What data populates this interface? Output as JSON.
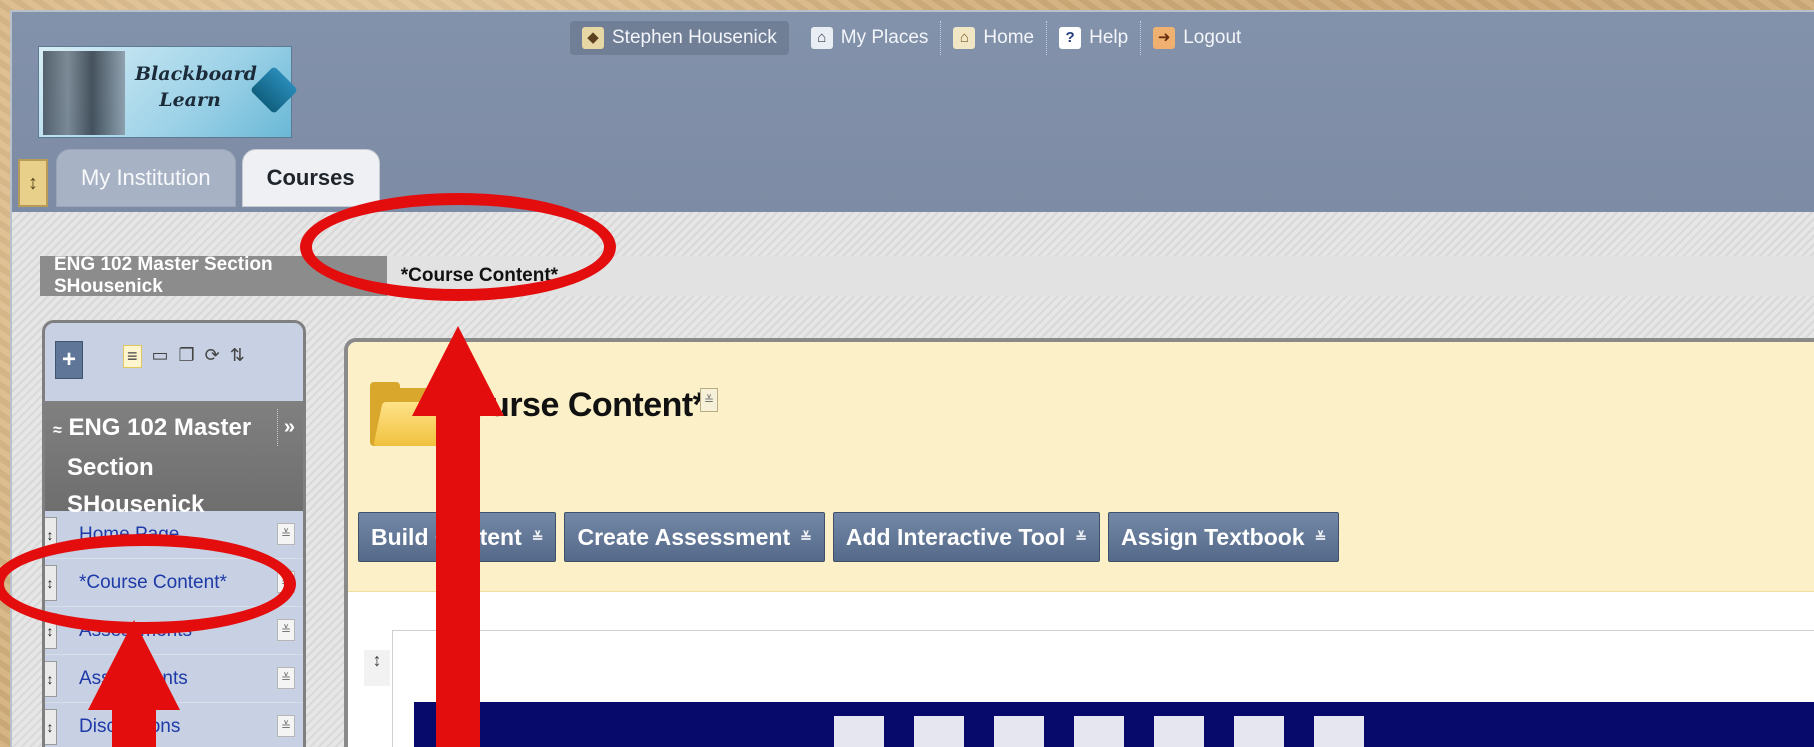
{
  "logo": {
    "line1": "Blackboard",
    "line2": "Learn"
  },
  "topnav": {
    "user": "Stephen Housenick",
    "my_places": "My Places",
    "home": "Home",
    "help": "Help",
    "logout": "Logout"
  },
  "tabs": {
    "toggle_icon": "↕",
    "my_institution": "My Institution",
    "courses": "Courses"
  },
  "breadcrumb": {
    "course": "ENG 102 Master Section SHousenick",
    "current": "*Course Content*"
  },
  "course_menu": {
    "add_button": "+",
    "title": "ENG 102 Master Section SHousenick",
    "title_line1": "ENG 102 Master",
    "title_line2": "Section",
    "title_line3": "SHousenick",
    "collapse_icon": "»",
    "expand_icon": "≈",
    "items": [
      {
        "label": "Home Page"
      },
      {
        "label": "*Course Content*"
      },
      {
        "label": "Assessments"
      },
      {
        "label": "Assignments"
      },
      {
        "label": "Discussions"
      }
    ]
  },
  "content": {
    "page_title": "*Course Content*",
    "actions": [
      {
        "label": "Build Content"
      },
      {
        "label": "Create Assessment"
      },
      {
        "label": "Add Interactive Tool"
      },
      {
        "label": "Assign Textbook"
      }
    ]
  },
  "colors": {
    "header": "#7d8ba4",
    "tab_active": "#eef0f3",
    "action_button": "#5c7090",
    "menu_bg": "#c7d1e3",
    "annotation_red": "#e40d0d"
  }
}
